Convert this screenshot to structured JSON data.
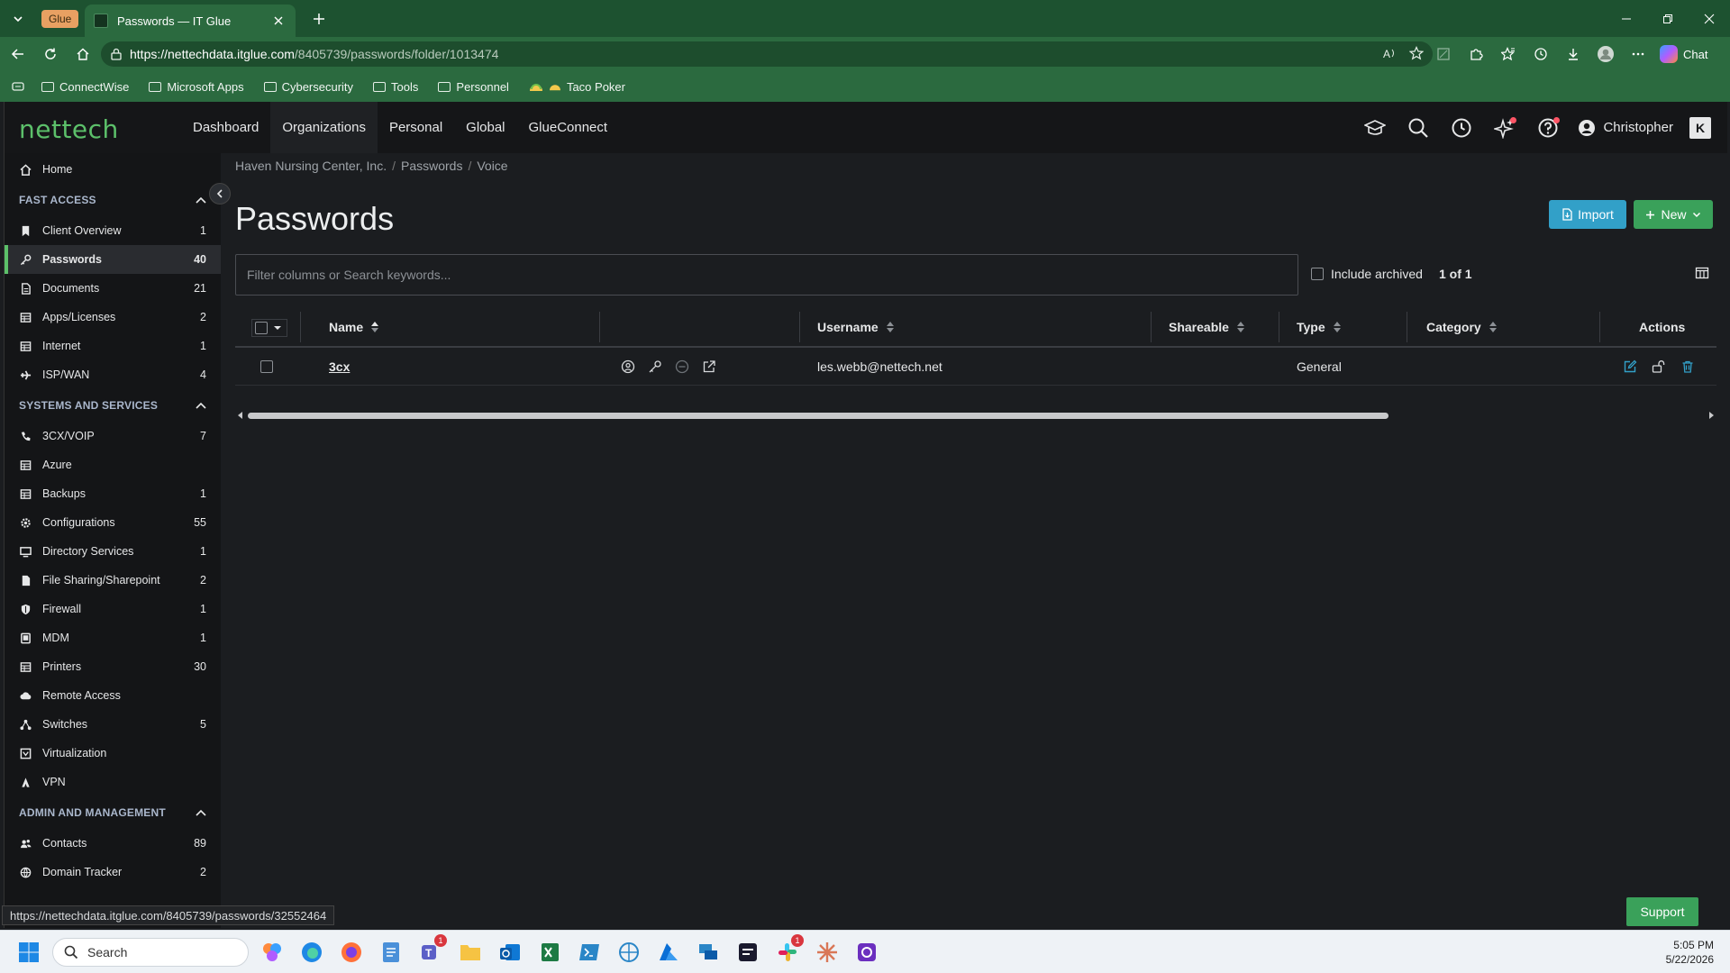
{
  "browser": {
    "tab_group": "Glue",
    "tab_title": "Passwords — IT Glue",
    "url_host": "https://nettechdata.itglue.com",
    "url_path": "/8405739/passwords/folder/1013474",
    "chat_label": "Chat",
    "bookmarks": [
      "ConnectWise",
      "Microsoft Apps",
      "Cybersecurity",
      "Tools",
      "Personnel",
      "Taco Poker"
    ]
  },
  "app": {
    "logo": "nettech",
    "nav": [
      {
        "label": "Dashboard"
      },
      {
        "label": "Organizations"
      },
      {
        "label": "Personal"
      },
      {
        "label": "Global"
      },
      {
        "label": "GlueConnect"
      }
    ],
    "user_name": "Christopher",
    "k_logo": "K"
  },
  "sidebar": {
    "home": "Home",
    "sections": [
      {
        "title": "FAST ACCESS",
        "items": [
          {
            "label": "Client Overview",
            "count": "1",
            "icon": "bookmark-icon"
          },
          {
            "label": "Passwords",
            "count": "40",
            "icon": "key-icon",
            "active": true
          },
          {
            "label": "Documents",
            "count": "21",
            "icon": "document-icon"
          },
          {
            "label": "Apps/Licenses",
            "count": "2",
            "icon": "grid-icon"
          },
          {
            "label": "Internet",
            "count": "1",
            "icon": "grid-icon"
          },
          {
            "label": "ISP/WAN",
            "count": "4",
            "icon": "plane-icon"
          }
        ]
      },
      {
        "title": "SYSTEMS AND SERVICES",
        "items": [
          {
            "label": "3CX/VOIP",
            "count": "7",
            "icon": "phone-icon"
          },
          {
            "label": "Azure",
            "count": "",
            "icon": "grid-icon"
          },
          {
            "label": "Backups",
            "count": "1",
            "icon": "grid-icon"
          },
          {
            "label": "Configurations",
            "count": "55",
            "icon": "gear-icon"
          },
          {
            "label": "Directory Services",
            "count": "1",
            "icon": "monitor-icon"
          },
          {
            "label": "File Sharing/Sharepoint",
            "count": "2",
            "icon": "file-icon"
          },
          {
            "label": "Firewall",
            "count": "1",
            "icon": "shield-icon"
          },
          {
            "label": "MDM",
            "count": "1",
            "icon": "tablet-icon"
          },
          {
            "label": "Printers",
            "count": "30",
            "icon": "grid-icon"
          },
          {
            "label": "Remote Access",
            "count": "",
            "icon": "cloud-icon"
          },
          {
            "label": "Switches",
            "count": "5",
            "icon": "network-icon"
          },
          {
            "label": "Virtualization",
            "count": "",
            "icon": "box-icon"
          },
          {
            "label": "VPN",
            "count": "",
            "icon": "person-icon"
          }
        ]
      },
      {
        "title": "ADMIN AND MANAGEMENT",
        "items": [
          {
            "label": "Contacts",
            "count": "89",
            "icon": "contacts-icon"
          },
          {
            "label": "Domain Tracker",
            "count": "2",
            "icon": "globe-icon"
          }
        ]
      }
    ]
  },
  "content": {
    "breadcrumb": [
      "Haven Nursing Center, Inc.",
      "Passwords",
      "Voice"
    ],
    "title": "Passwords",
    "import_label": "Import",
    "new_label": "New",
    "search_placeholder": "Filter columns or Search keywords...",
    "include_archived": "Include archived",
    "pager": "1 of 1",
    "columns": {
      "name": "Name",
      "username": "Username",
      "shareable": "Shareable",
      "type": "Type",
      "category": "Category",
      "actions": "Actions"
    },
    "rows": [
      {
        "name": "3cx",
        "username": "les.webb@nettech.net",
        "shareable": "",
        "type": "General",
        "category": ""
      }
    ]
  },
  "status_url": "https://nettechdata.itglue.com/8405739/passwords/32552464",
  "support_label": "Support",
  "taskbar": {
    "search_placeholder": "Search",
    "time": "5:05 PM",
    "date": "5/22/2026",
    "teams_badge": "1",
    "slack_badge": "1"
  }
}
